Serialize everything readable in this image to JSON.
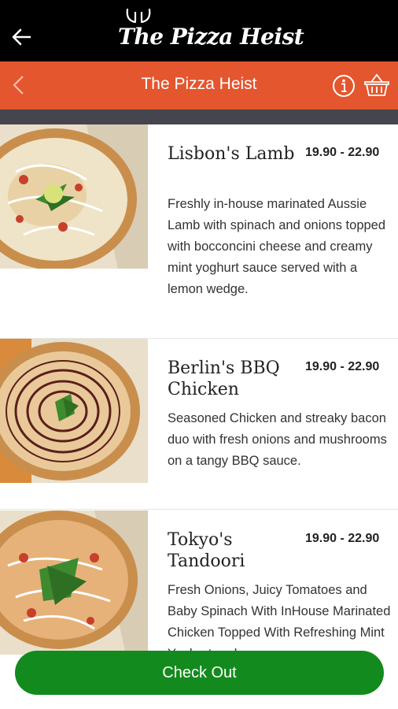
{
  "header": {
    "logo_text": "The Pizza Heist",
    "back_icon": "arrow-left-icon"
  },
  "navbar": {
    "title": "The Pizza Heist",
    "back_icon": "chevron-left-icon",
    "info_icon": "info-icon",
    "basket_icon": "basket-icon",
    "color": "#e4562e"
  },
  "menu": {
    "items": [
      {
        "name": "Lisbon's Lamb",
        "price": "19.90 - 22.90",
        "description": "Freshly in-house marinated Aussie Lamb with spinach and onions topped with bocconcini cheese and creamy mint yoghurt sauce served with a lemon wedge."
      },
      {
        "name": "Berlin's BBQ Chicken",
        "price": "19.90 - 22.90",
        "description": "Seasoned Chicken and streaky bacon duo with fresh onions and mushrooms on a tangy BBQ sauce."
      },
      {
        "name": "Tokyo's Tandoori",
        "price": "19.90 - 22.90",
        "description": "Fresh Onions, Juicy Tomatoes and Baby Spinach With InHouse Marinated Chicken Topped With Refreshing Mint Yoghurt and"
      }
    ]
  },
  "checkout": {
    "label": "Check Out",
    "color": "#138a1e"
  }
}
